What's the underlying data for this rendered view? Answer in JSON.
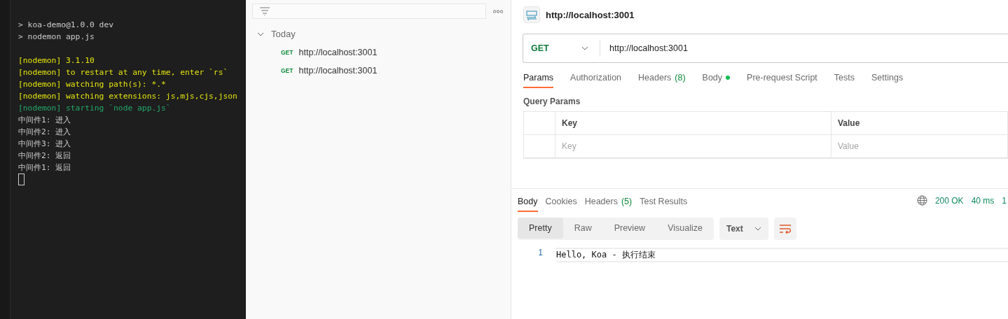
{
  "terminal": {
    "lines": [
      {
        "kind": "blank"
      },
      {
        "kind": "plain",
        "text": "> koa-demo@1.0.0 dev"
      },
      {
        "kind": "plain",
        "text": "> nodemon app.js"
      },
      {
        "kind": "blank"
      },
      {
        "kind": "warn",
        "text": "[nodemon] 3.1.10"
      },
      {
        "kind": "warn",
        "text": "[nodemon] to restart at any time, enter `rs`"
      },
      {
        "kind": "warn",
        "text": "[nodemon] watching path(s): *.*"
      },
      {
        "kind": "warn",
        "text": "[nodemon] watching extensions: js,mjs,cjs,json"
      },
      {
        "kind": "ok",
        "text": "[nodemon] starting `node app.js`"
      },
      {
        "kind": "plain",
        "text": "中间件1: 进入"
      },
      {
        "kind": "plain",
        "text": "中间件2: 进入"
      },
      {
        "kind": "plain",
        "text": "中间件3: 进入"
      },
      {
        "kind": "plain",
        "text": "中间件2: 返回"
      },
      {
        "kind": "plain",
        "text": "中间件1: 返回"
      }
    ],
    "cursor": true
  },
  "history": {
    "groups": [
      {
        "label": "Today",
        "expanded": true,
        "items": [
          {
            "method": "GET",
            "url": "http://localhost:3001"
          },
          {
            "method": "GET",
            "url": "http://localhost:3001"
          }
        ]
      }
    ]
  },
  "request": {
    "title": "http://localhost:3001",
    "method": "GET",
    "url": "http://localhost:3001",
    "tabs": [
      {
        "label": "Params",
        "selected": true
      },
      {
        "label": "Authorization",
        "selected": false
      },
      {
        "label": "Headers",
        "count": "(8)",
        "selected": false
      },
      {
        "label": "Body",
        "dot": true,
        "selected": false
      },
      {
        "label": "Pre-request Script",
        "selected": false
      },
      {
        "label": "Tests",
        "selected": false
      },
      {
        "label": "Settings",
        "selected": false
      }
    ],
    "query_params": {
      "title": "Query Params",
      "columns": [
        "Key",
        "Value"
      ],
      "placeholders": [
        "Key",
        "Value"
      ]
    }
  },
  "response": {
    "tabs": [
      {
        "label": "Body",
        "selected": true
      },
      {
        "label": "Cookies",
        "selected": false
      },
      {
        "label": "Headers",
        "count": "(5)",
        "selected": false
      },
      {
        "label": "Test Results",
        "selected": false
      }
    ],
    "status": "200 OK",
    "time": "40 ms",
    "size": "1",
    "views": [
      {
        "label": "Pretty",
        "selected": true
      },
      {
        "label": "Raw",
        "selected": false
      },
      {
        "label": "Preview",
        "selected": false
      },
      {
        "label": "Visualize",
        "selected": false
      }
    ],
    "format": "Text",
    "lines": [
      {
        "number": "1",
        "text": "Hello, Koa - 执行结束"
      }
    ]
  }
}
